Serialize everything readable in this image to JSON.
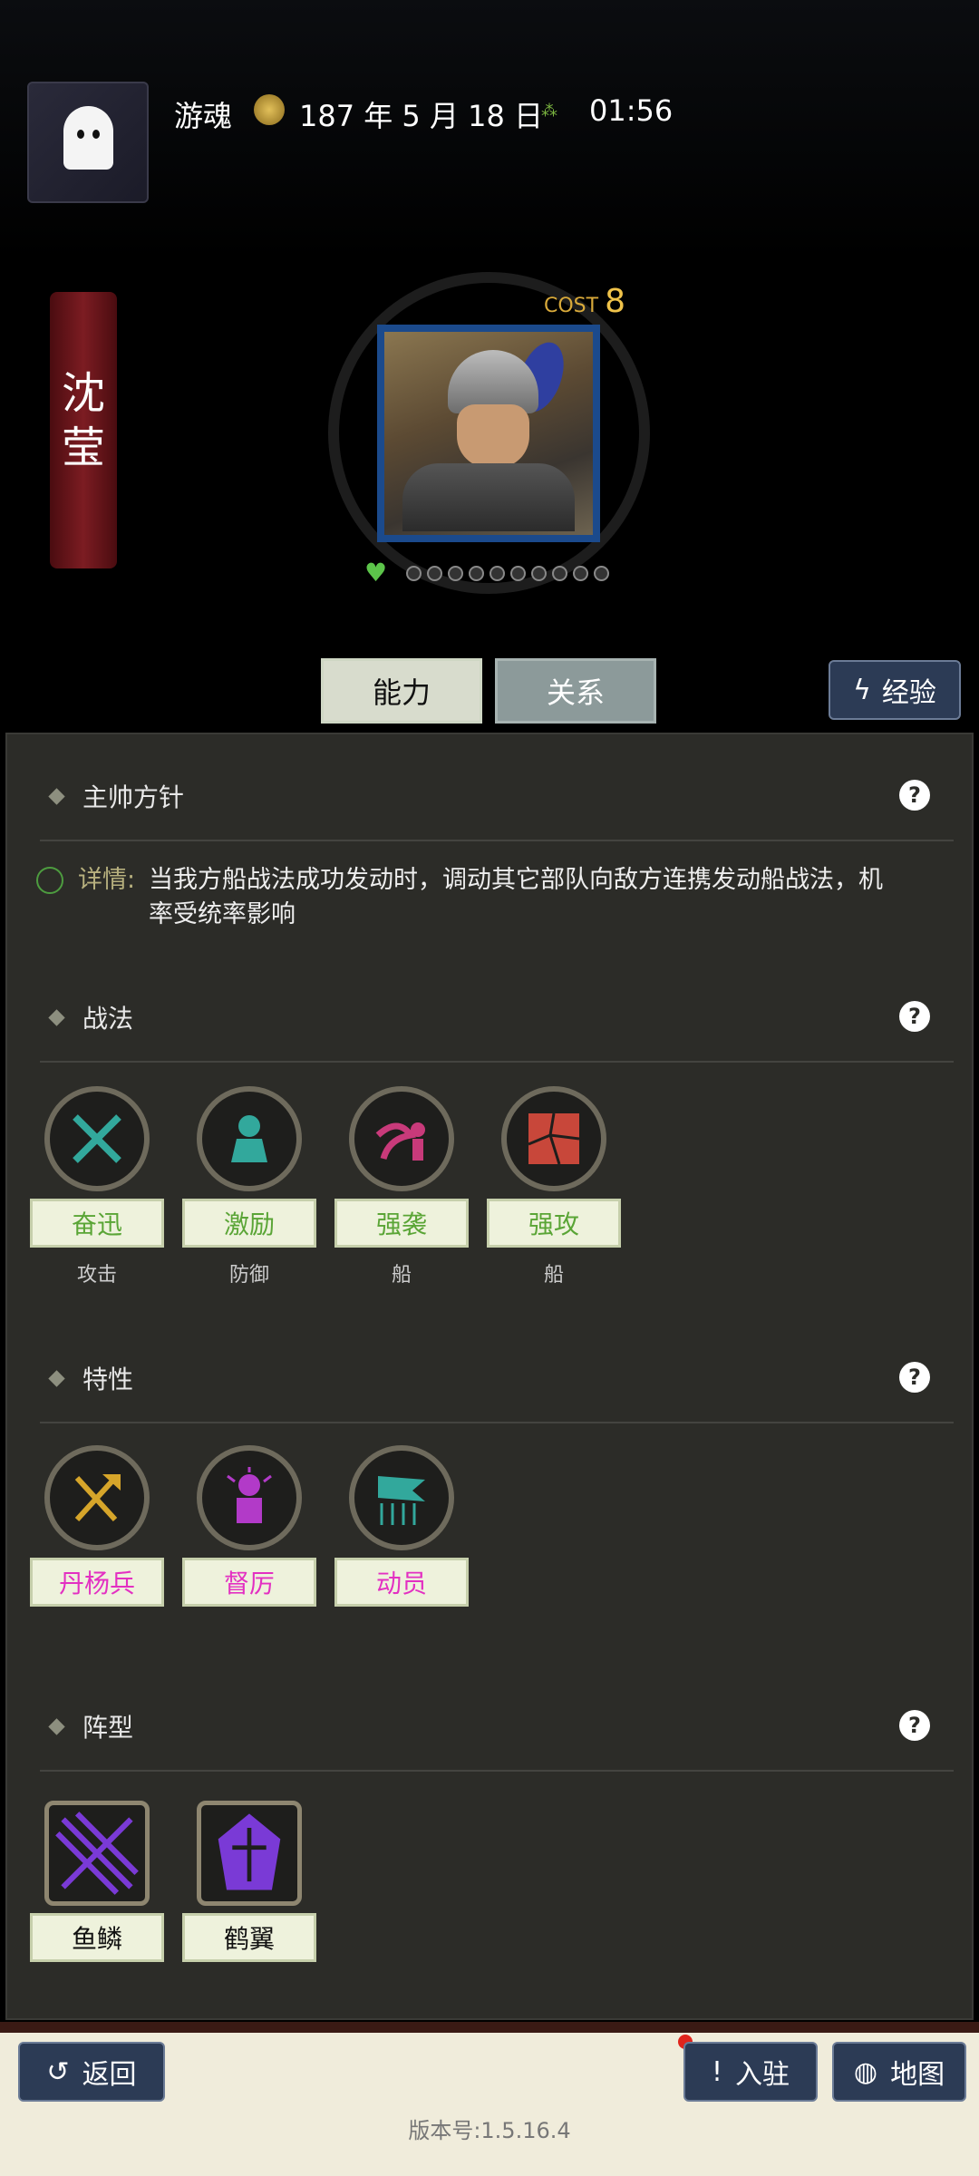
{
  "header": {
    "user_name": "游魂",
    "date": "187 年 5 月 18 日",
    "time": "01:56"
  },
  "general": {
    "name_chars": [
      "沈",
      "莹"
    ],
    "cost_label": "COST",
    "cost_value": "8",
    "stars_total": 10,
    "stars_filled": 0
  },
  "tabs": {
    "ability": "能力",
    "relation": "关系",
    "experience": "经验"
  },
  "sections": {
    "commander_policy": {
      "title": "主帅方针",
      "details_label": "详情:",
      "details_text": "当我方船战法成功发动时，调动其它部队向敌方连携发动船战法，机率受统率影响"
    },
    "tactics": {
      "title": "战法",
      "items": [
        {
          "name": "奋迅",
          "type": "攻击",
          "icon": "crossed-swords-icon",
          "color": "#32a89c"
        },
        {
          "name": "激励",
          "type": "防御",
          "icon": "rally-soldier-icon",
          "color": "#32a89c"
        },
        {
          "name": "强袭",
          "type": "船",
          "icon": "raid-icon",
          "color": "#c83a7a"
        },
        {
          "name": "强攻",
          "type": "船",
          "icon": "shatter-icon",
          "color": "#c8473a"
        }
      ]
    },
    "traits": {
      "title": "特性",
      "items": [
        {
          "name": "丹杨兵",
          "icon": "axe-icon",
          "color": "#d6a52a"
        },
        {
          "name": "督厉",
          "icon": "commander-icon",
          "color": "#b23ac8"
        },
        {
          "name": "动员",
          "icon": "flag-spears-icon",
          "color": "#32a89c"
        }
      ]
    },
    "formations": {
      "title": "阵型",
      "items": [
        {
          "name": "鱼鳞",
          "icon": "fish-scale-icon",
          "color": "#7a3ad6"
        },
        {
          "name": "鹤翼",
          "icon": "crane-wing-icon",
          "color": "#7a3ad6"
        }
      ]
    }
  },
  "footer": {
    "back": "返回",
    "station": "入驻",
    "map": "地图",
    "version": "版本号:1.5.16.4"
  },
  "colors": {
    "accent_green": "#5aa536",
    "trait_pink": "#e330c2",
    "button_blue": "#2c3b55"
  }
}
